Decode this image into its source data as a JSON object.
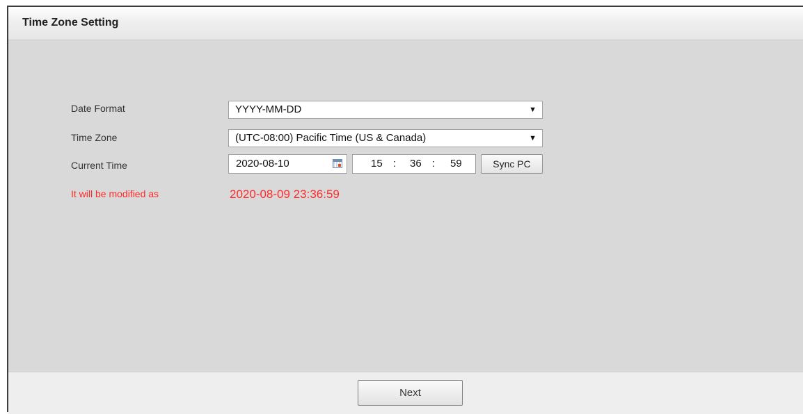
{
  "header": {
    "title": "Time Zone Setting"
  },
  "form": {
    "date_format": {
      "label": "Date Format",
      "value": "YYYY-MM-DD"
    },
    "time_zone": {
      "label": "Time Zone",
      "value": "(UTC-08:00) Pacific Time (US & Canada)"
    },
    "current_time": {
      "label": "Current Time",
      "date": "2020-08-10",
      "hour": "15",
      "minute": "36",
      "second": "59",
      "separator": ":",
      "sync_label": "Sync PC"
    },
    "modified": {
      "label": "It will be modified as",
      "value": "2020-08-09 23:36:59"
    }
  },
  "footer": {
    "next_label": "Next"
  },
  "icons": {
    "dropdown": "chevron-down-icon",
    "calendar": "calendar-icon"
  },
  "colors": {
    "warning": "#ff2a2a"
  }
}
